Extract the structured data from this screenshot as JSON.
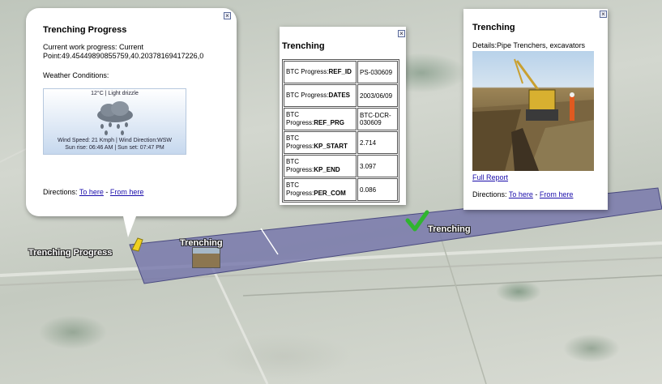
{
  "popup_progress": {
    "title": "Trenching Progress",
    "progress_text": "Current work progress: Current Point:49.45449890855759,40.20378169417226,0",
    "weather_label": "Weather Conditions:",
    "weather": {
      "condition": "12°C  | Light drizzle",
      "wind": "Wind Speed: 21 Kmph  |  Wind Direction:WSW",
      "sun": "Sun rise: 06:46 AM  |  Sun set: 07:47 PM"
    },
    "directions_label": "Directions:",
    "to_here": "To here",
    "separator": "-",
    "from_here": "From here",
    "close_glyph": "×"
  },
  "popup_table": {
    "title": "Trenching",
    "close_glyph": "×",
    "rows": [
      {
        "prefix": "BTC Progress:",
        "key": "REF_ID",
        "value": "PS-030609"
      },
      {
        "prefix": "BTC Progress:",
        "key": "DATES",
        "value": "2003/06/09"
      },
      {
        "prefix": "BTC Progress:",
        "key": "REF_PRG",
        "value": "BTC-DCR-030609"
      },
      {
        "prefix": "BTC Progress:",
        "key": "KP_START",
        "value": "2.714"
      },
      {
        "prefix": "BTC Progress:",
        "key": "KP_END",
        "value": "3.097"
      },
      {
        "prefix": "BTC Progress:",
        "key": "PER_COM",
        "value": "0.086"
      }
    ]
  },
  "popup_details": {
    "title": "Trenching",
    "details": "Details:Pipe Trenchers, excavators",
    "full_report": "Full Report",
    "directions_label": "Directions:",
    "to_here": "To here",
    "separator": "-",
    "from_here": "From here",
    "close_glyph": "×"
  },
  "map_labels": {
    "trenching_progress": "Trenching Progress",
    "trenching_1": "Trenching",
    "trenching_2": "Trenching"
  },
  "colors": {
    "route_fill": "#6e6ea8",
    "checkmark": "#2fb52f",
    "pin": "#f0d020"
  }
}
